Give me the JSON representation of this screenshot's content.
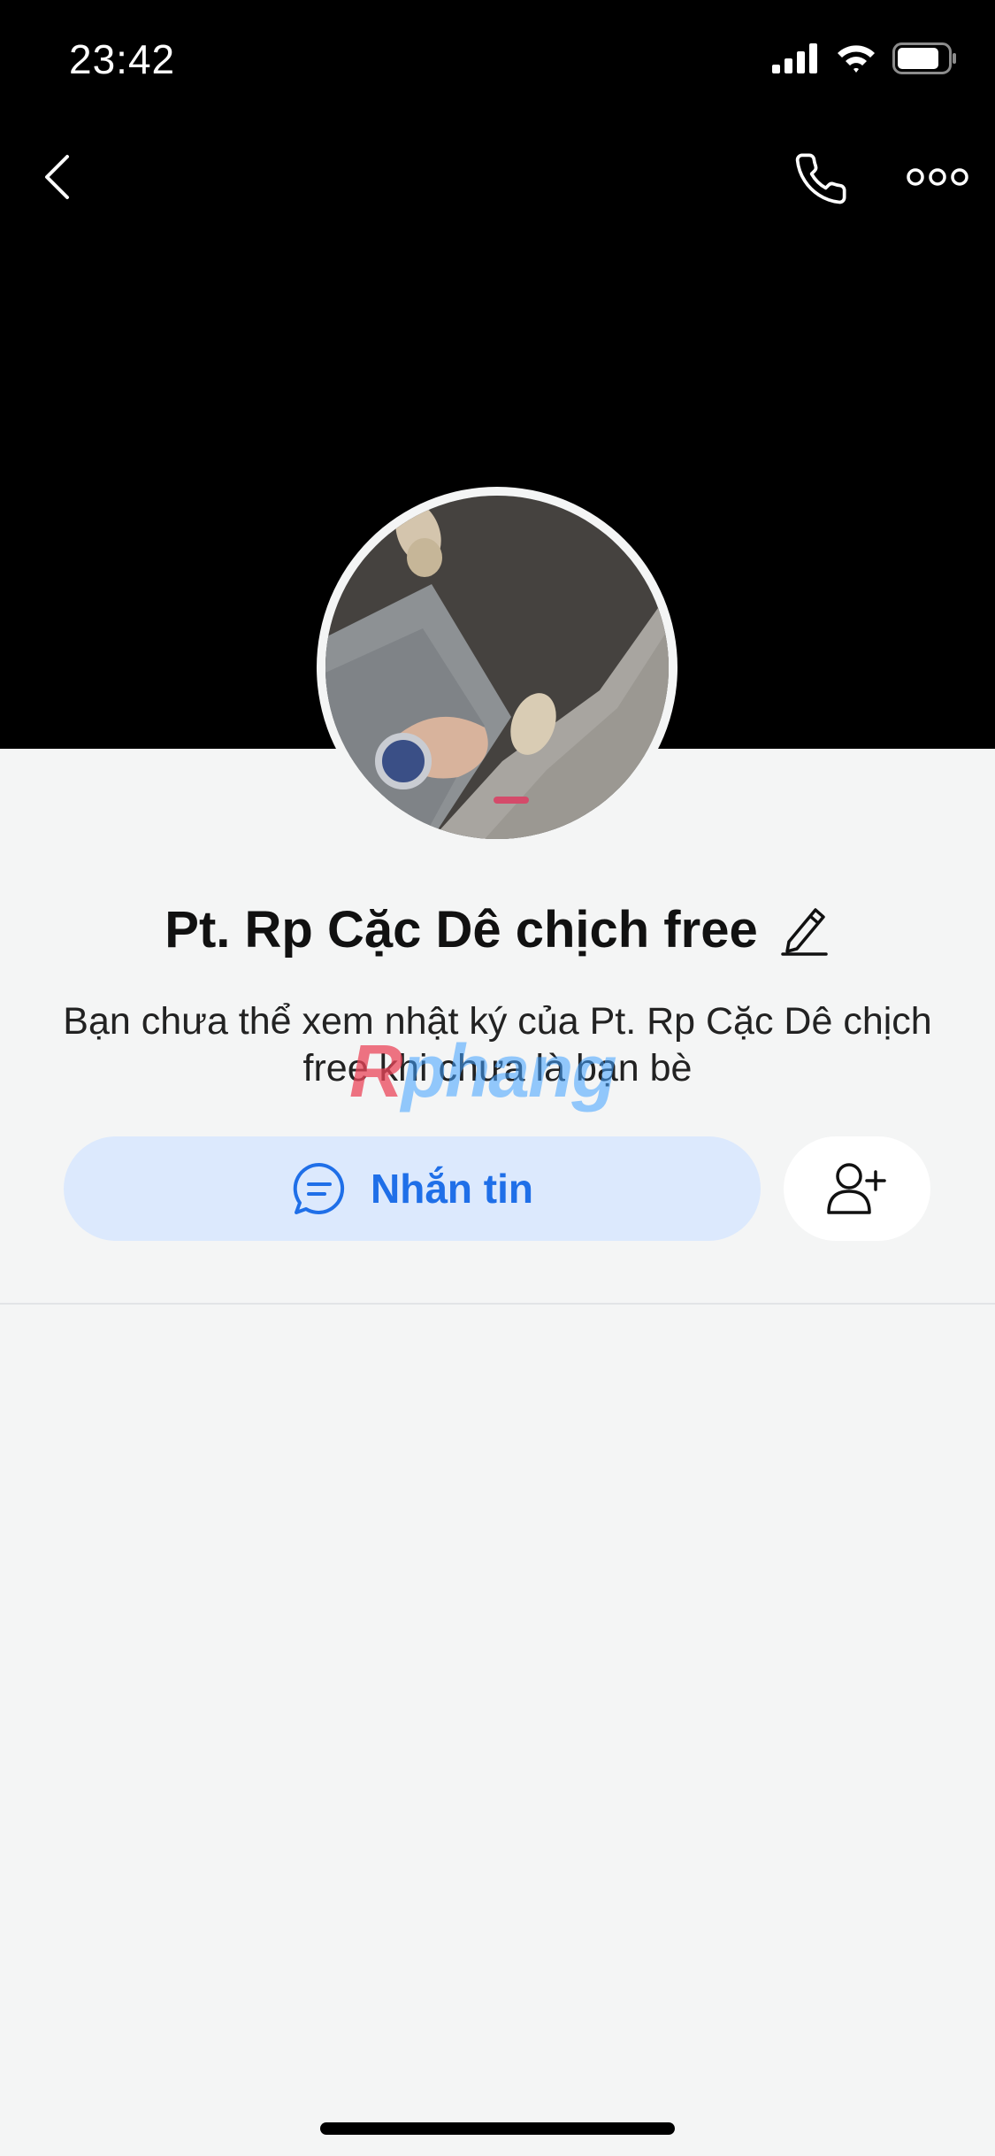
{
  "status_bar": {
    "time": "23:42",
    "icons": [
      "signal-icon",
      "wifi-icon",
      "battery-icon"
    ]
  },
  "nav": {
    "back_icon": "chevron-left-icon",
    "call_icon": "phone-icon",
    "more_icon": "more-horizontal-icon"
  },
  "profile": {
    "name": "Pt. Rp Cặc Dê chịch free",
    "edit_icon": "pencil-icon",
    "notice": "Bạn chưa thể xem nhật ký của Pt. Rp Cặc Dê chịch free khi chưa là bạn bè"
  },
  "watermark": {
    "first": "R",
    "rest": "phang"
  },
  "actions": {
    "message_label": "Nhắn tin",
    "message_icon": "chat-bubble-icon",
    "add_friend_icon": "add-user-icon"
  },
  "colors": {
    "accent": "#1f6fe8",
    "message_button_bg": "#dce9fd",
    "cover_bg": "#000000",
    "page_bg": "#f4f5f5"
  }
}
